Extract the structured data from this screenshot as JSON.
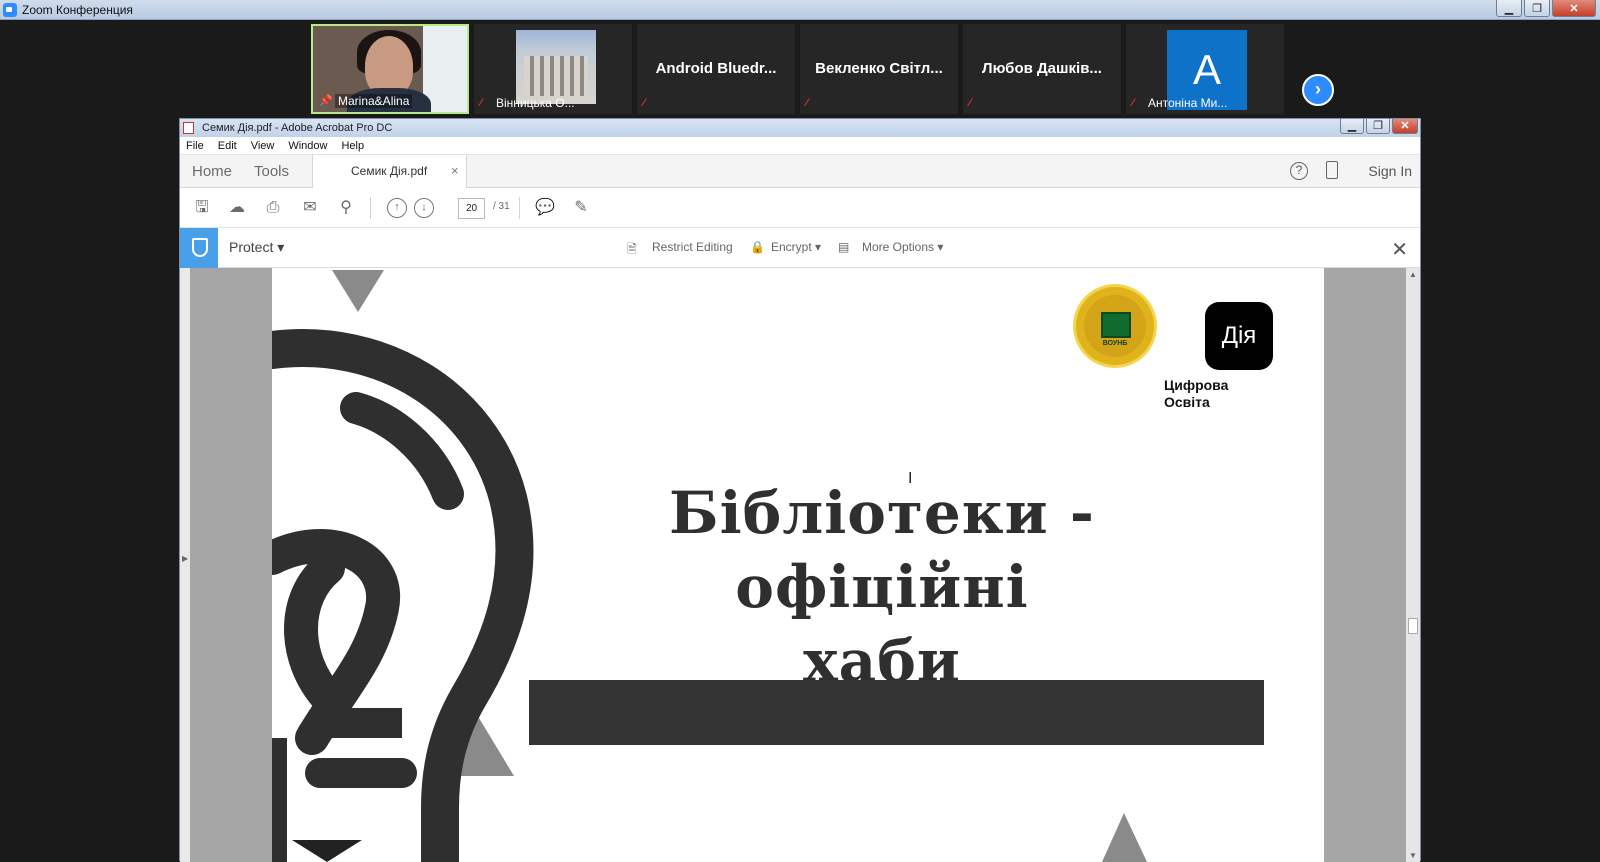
{
  "zoom": {
    "window_title": "Zoom Конференция",
    "participants": [
      {
        "name": "Marina&Alina"
      },
      {
        "name": "Вінницька О..."
      },
      {
        "name": "Android  Bluedr..."
      },
      {
        "name": "Векленко  Світл..."
      },
      {
        "name": "Любов  Дашків..."
      },
      {
        "name": "Антоніна Ми...",
        "avatar_letter": "A"
      }
    ]
  },
  "acrobat": {
    "window_title": "Семик Дія.pdf - Adobe Acrobat Pro DC",
    "menu": [
      "File",
      "Edit",
      "View",
      "Window",
      "Help"
    ],
    "tabs": {
      "home": "Home",
      "tools": "Tools",
      "document": "Семик Дія.pdf"
    },
    "sign_in": "Sign In",
    "help_glyph": "?",
    "page_current": "20",
    "page_total": "/ 31",
    "protect": {
      "label": "Protect",
      "restrict_editing": "Restrict Editing",
      "encrypt": "Encrypt",
      "more_options": "More Options"
    }
  },
  "slide": {
    "title_line1": "Бібліотеки -",
    "title_line2": "офіційні хаби",
    "logo_vounb_text": "ВОУНБ",
    "logo_diya_text": "Дія",
    "digital_edu_line1": "Цифрова",
    "digital_edu_line2": "Освіта"
  },
  "colors": {
    "zoom_blue": "#2d8cff",
    "protect_blue": "#4aa0e8",
    "slide_dark": "#333333",
    "active_speaker": "#b8e986"
  }
}
